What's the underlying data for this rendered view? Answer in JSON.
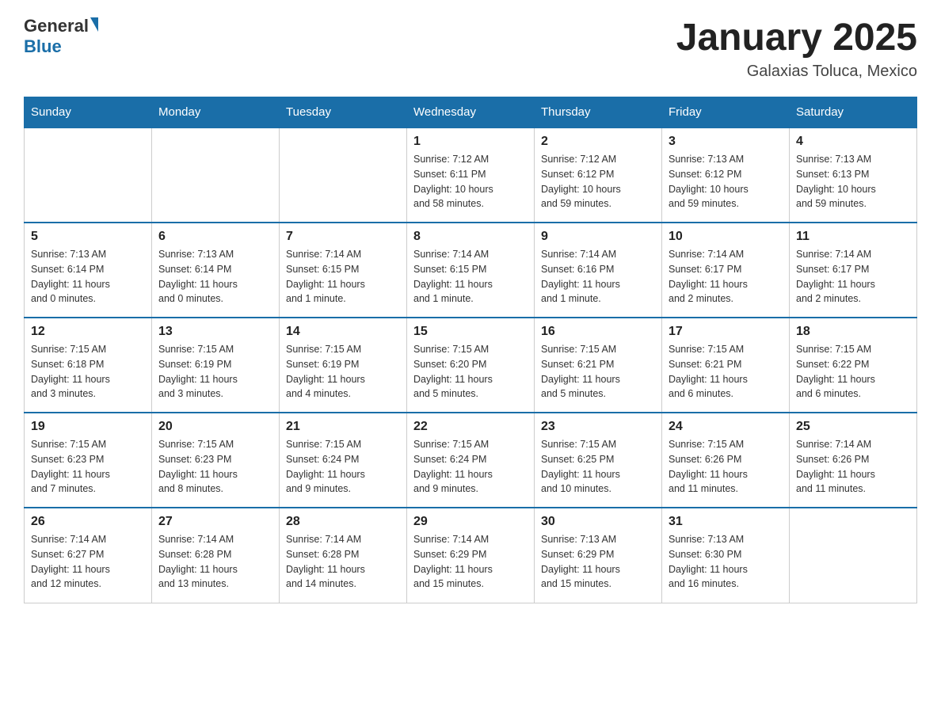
{
  "header": {
    "logo_general": "General",
    "logo_blue": "Blue",
    "title": "January 2025",
    "location": "Galaxias Toluca, Mexico"
  },
  "weekdays": [
    "Sunday",
    "Monday",
    "Tuesday",
    "Wednesday",
    "Thursday",
    "Friday",
    "Saturday"
  ],
  "weeks": [
    [
      {
        "day": "",
        "info": ""
      },
      {
        "day": "",
        "info": ""
      },
      {
        "day": "",
        "info": ""
      },
      {
        "day": "1",
        "info": "Sunrise: 7:12 AM\nSunset: 6:11 PM\nDaylight: 10 hours\nand 58 minutes."
      },
      {
        "day": "2",
        "info": "Sunrise: 7:12 AM\nSunset: 6:12 PM\nDaylight: 10 hours\nand 59 minutes."
      },
      {
        "day": "3",
        "info": "Sunrise: 7:13 AM\nSunset: 6:12 PM\nDaylight: 10 hours\nand 59 minutes."
      },
      {
        "day": "4",
        "info": "Sunrise: 7:13 AM\nSunset: 6:13 PM\nDaylight: 10 hours\nand 59 minutes."
      }
    ],
    [
      {
        "day": "5",
        "info": "Sunrise: 7:13 AM\nSunset: 6:14 PM\nDaylight: 11 hours\nand 0 minutes."
      },
      {
        "day": "6",
        "info": "Sunrise: 7:13 AM\nSunset: 6:14 PM\nDaylight: 11 hours\nand 0 minutes."
      },
      {
        "day": "7",
        "info": "Sunrise: 7:14 AM\nSunset: 6:15 PM\nDaylight: 11 hours\nand 1 minute."
      },
      {
        "day": "8",
        "info": "Sunrise: 7:14 AM\nSunset: 6:15 PM\nDaylight: 11 hours\nand 1 minute."
      },
      {
        "day": "9",
        "info": "Sunrise: 7:14 AM\nSunset: 6:16 PM\nDaylight: 11 hours\nand 1 minute."
      },
      {
        "day": "10",
        "info": "Sunrise: 7:14 AM\nSunset: 6:17 PM\nDaylight: 11 hours\nand 2 minutes."
      },
      {
        "day": "11",
        "info": "Sunrise: 7:14 AM\nSunset: 6:17 PM\nDaylight: 11 hours\nand 2 minutes."
      }
    ],
    [
      {
        "day": "12",
        "info": "Sunrise: 7:15 AM\nSunset: 6:18 PM\nDaylight: 11 hours\nand 3 minutes."
      },
      {
        "day": "13",
        "info": "Sunrise: 7:15 AM\nSunset: 6:19 PM\nDaylight: 11 hours\nand 3 minutes."
      },
      {
        "day": "14",
        "info": "Sunrise: 7:15 AM\nSunset: 6:19 PM\nDaylight: 11 hours\nand 4 minutes."
      },
      {
        "day": "15",
        "info": "Sunrise: 7:15 AM\nSunset: 6:20 PM\nDaylight: 11 hours\nand 5 minutes."
      },
      {
        "day": "16",
        "info": "Sunrise: 7:15 AM\nSunset: 6:21 PM\nDaylight: 11 hours\nand 5 minutes."
      },
      {
        "day": "17",
        "info": "Sunrise: 7:15 AM\nSunset: 6:21 PM\nDaylight: 11 hours\nand 6 minutes."
      },
      {
        "day": "18",
        "info": "Sunrise: 7:15 AM\nSunset: 6:22 PM\nDaylight: 11 hours\nand 6 minutes."
      }
    ],
    [
      {
        "day": "19",
        "info": "Sunrise: 7:15 AM\nSunset: 6:23 PM\nDaylight: 11 hours\nand 7 minutes."
      },
      {
        "day": "20",
        "info": "Sunrise: 7:15 AM\nSunset: 6:23 PM\nDaylight: 11 hours\nand 8 minutes."
      },
      {
        "day": "21",
        "info": "Sunrise: 7:15 AM\nSunset: 6:24 PM\nDaylight: 11 hours\nand 9 minutes."
      },
      {
        "day": "22",
        "info": "Sunrise: 7:15 AM\nSunset: 6:24 PM\nDaylight: 11 hours\nand 9 minutes."
      },
      {
        "day": "23",
        "info": "Sunrise: 7:15 AM\nSunset: 6:25 PM\nDaylight: 11 hours\nand 10 minutes."
      },
      {
        "day": "24",
        "info": "Sunrise: 7:15 AM\nSunset: 6:26 PM\nDaylight: 11 hours\nand 11 minutes."
      },
      {
        "day": "25",
        "info": "Sunrise: 7:14 AM\nSunset: 6:26 PM\nDaylight: 11 hours\nand 11 minutes."
      }
    ],
    [
      {
        "day": "26",
        "info": "Sunrise: 7:14 AM\nSunset: 6:27 PM\nDaylight: 11 hours\nand 12 minutes."
      },
      {
        "day": "27",
        "info": "Sunrise: 7:14 AM\nSunset: 6:28 PM\nDaylight: 11 hours\nand 13 minutes."
      },
      {
        "day": "28",
        "info": "Sunrise: 7:14 AM\nSunset: 6:28 PM\nDaylight: 11 hours\nand 14 minutes."
      },
      {
        "day": "29",
        "info": "Sunrise: 7:14 AM\nSunset: 6:29 PM\nDaylight: 11 hours\nand 15 minutes."
      },
      {
        "day": "30",
        "info": "Sunrise: 7:13 AM\nSunset: 6:29 PM\nDaylight: 11 hours\nand 15 minutes."
      },
      {
        "day": "31",
        "info": "Sunrise: 7:13 AM\nSunset: 6:30 PM\nDaylight: 11 hours\nand 16 minutes."
      },
      {
        "day": "",
        "info": ""
      }
    ]
  ]
}
